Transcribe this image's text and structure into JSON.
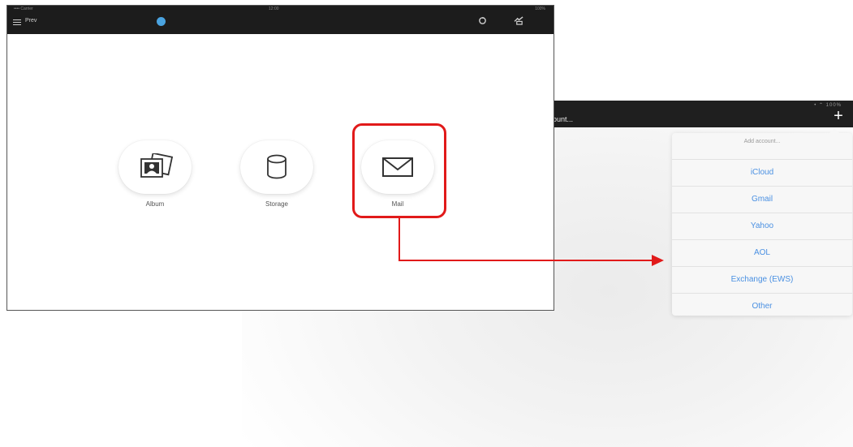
{
  "front": {
    "status_left": "•••• Carrier",
    "status_center": "12:00",
    "status_right": "100%",
    "title": "Prev",
    "tiles": [
      {
        "label": "Album",
        "icon": "album-photos-icon"
      },
      {
        "label": "Storage",
        "icon": "storage-cylinder-icon"
      },
      {
        "label": "Mail",
        "icon": "mail-envelope-icon"
      }
    ]
  },
  "back": {
    "status_right": "• ⌃ 100%",
    "title": "ount...",
    "plus_label": "+",
    "popover": {
      "header": "Add account...",
      "items": [
        "iCloud",
        "Gmail",
        "Yahoo",
        "AOL",
        "Exchange (EWS)",
        "Other"
      ]
    }
  },
  "colors": {
    "highlight": "#e11a1a",
    "link_blue": "#4a90e2",
    "bar_dark": "#1c1c1c"
  }
}
